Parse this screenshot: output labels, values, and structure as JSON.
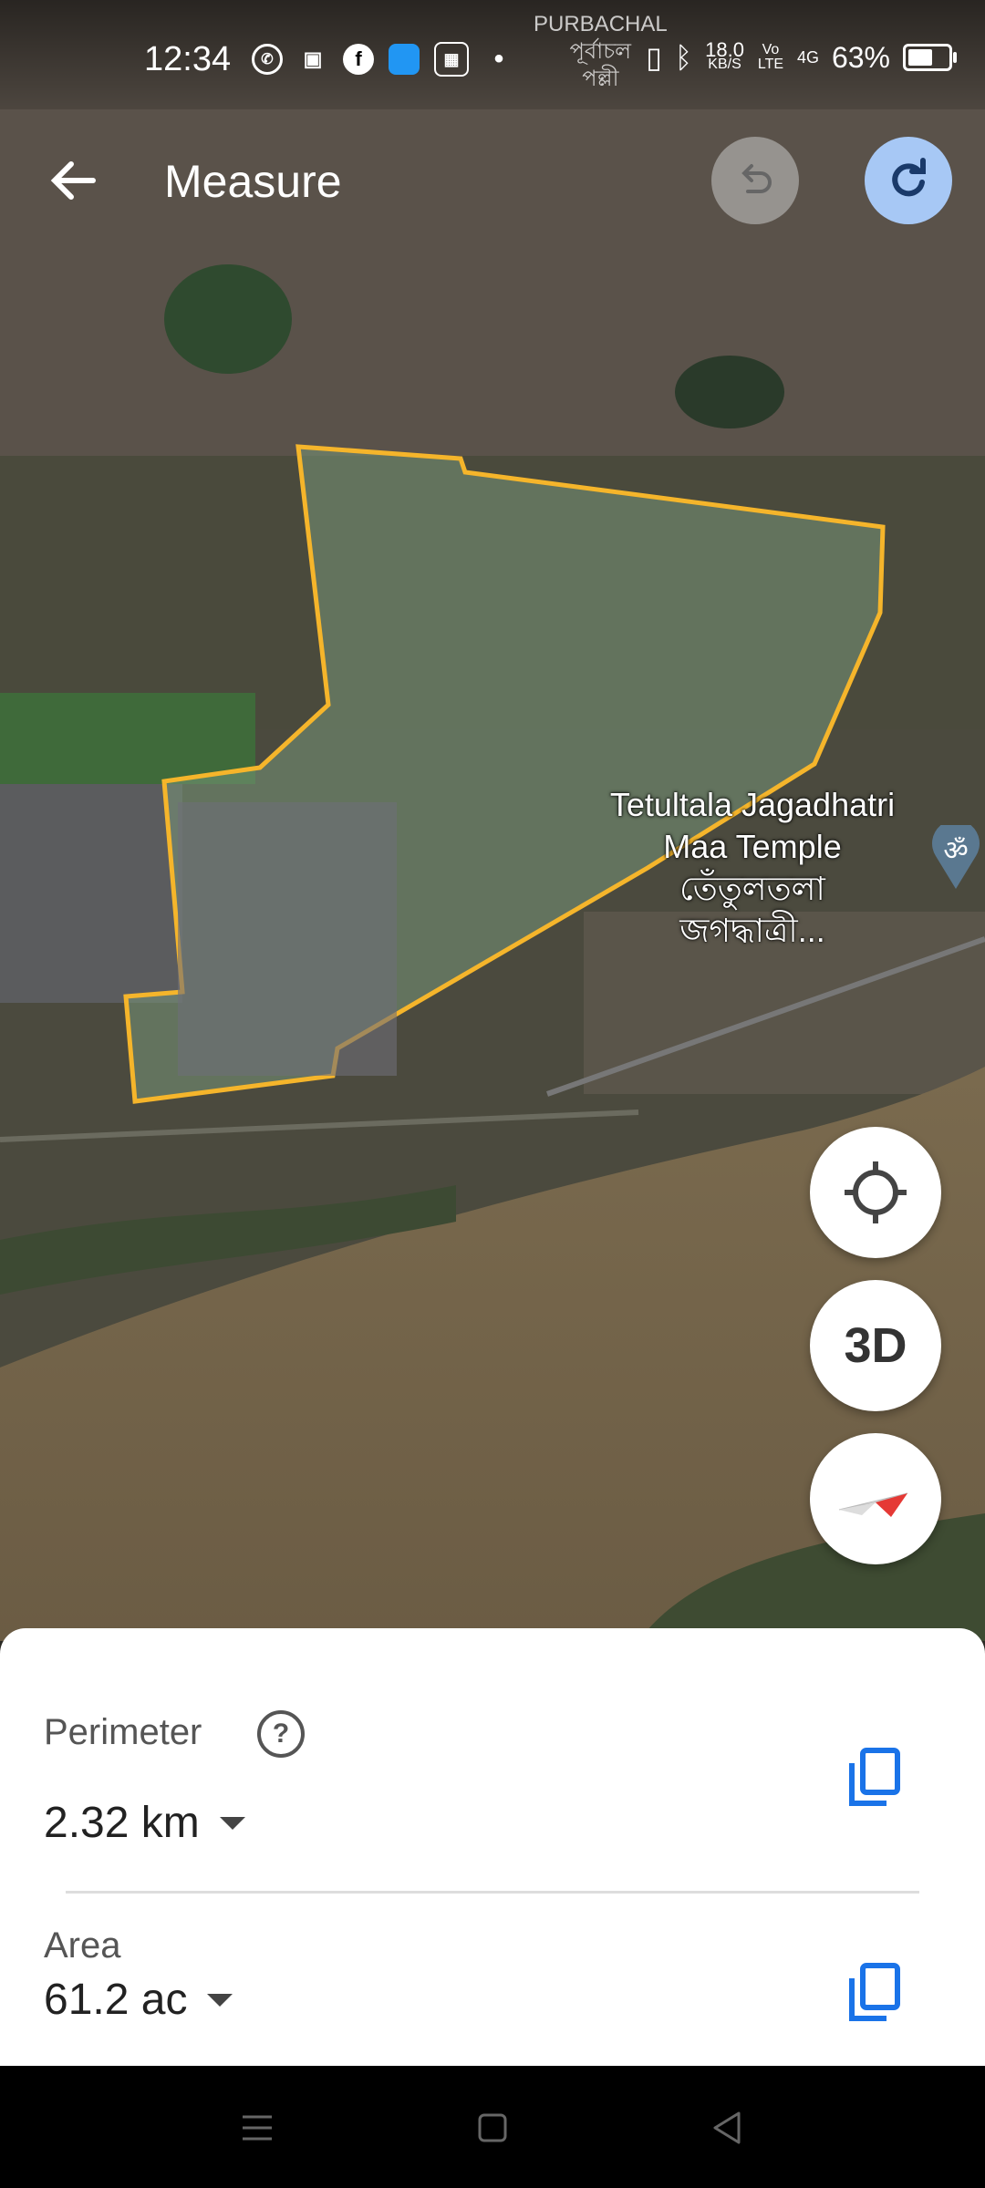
{
  "status_bar": {
    "time": "12:34",
    "net_speed_value": "18.0",
    "net_speed_unit": "KB/S",
    "volte": "Vo LTE",
    "signal": "4G",
    "battery": "63%",
    "battery_level": 0.63
  },
  "map": {
    "area_label_top": "PURBACHAL",
    "area_label_top_bn": "পূর্বাচল",
    "area_label_top_bn2": "পল্লী",
    "poi_name_line1": "Tetultala Jagadhatri",
    "poi_name_line2": "Maa Temple",
    "poi_name_bn_line1": "তেঁতুলতলা",
    "poi_name_bn_line2": "জগদ্ধাত্রী...",
    "poi_icon": "om-pin-icon",
    "outline_color": "#f5b52b"
  },
  "header": {
    "title": "Measure"
  },
  "controls": {
    "three_d_label": "3D"
  },
  "sheet": {
    "perimeter_label": "Perimeter",
    "perimeter_value": "2.32 km",
    "area_label": "Area",
    "area_value": "61.2 ac"
  }
}
